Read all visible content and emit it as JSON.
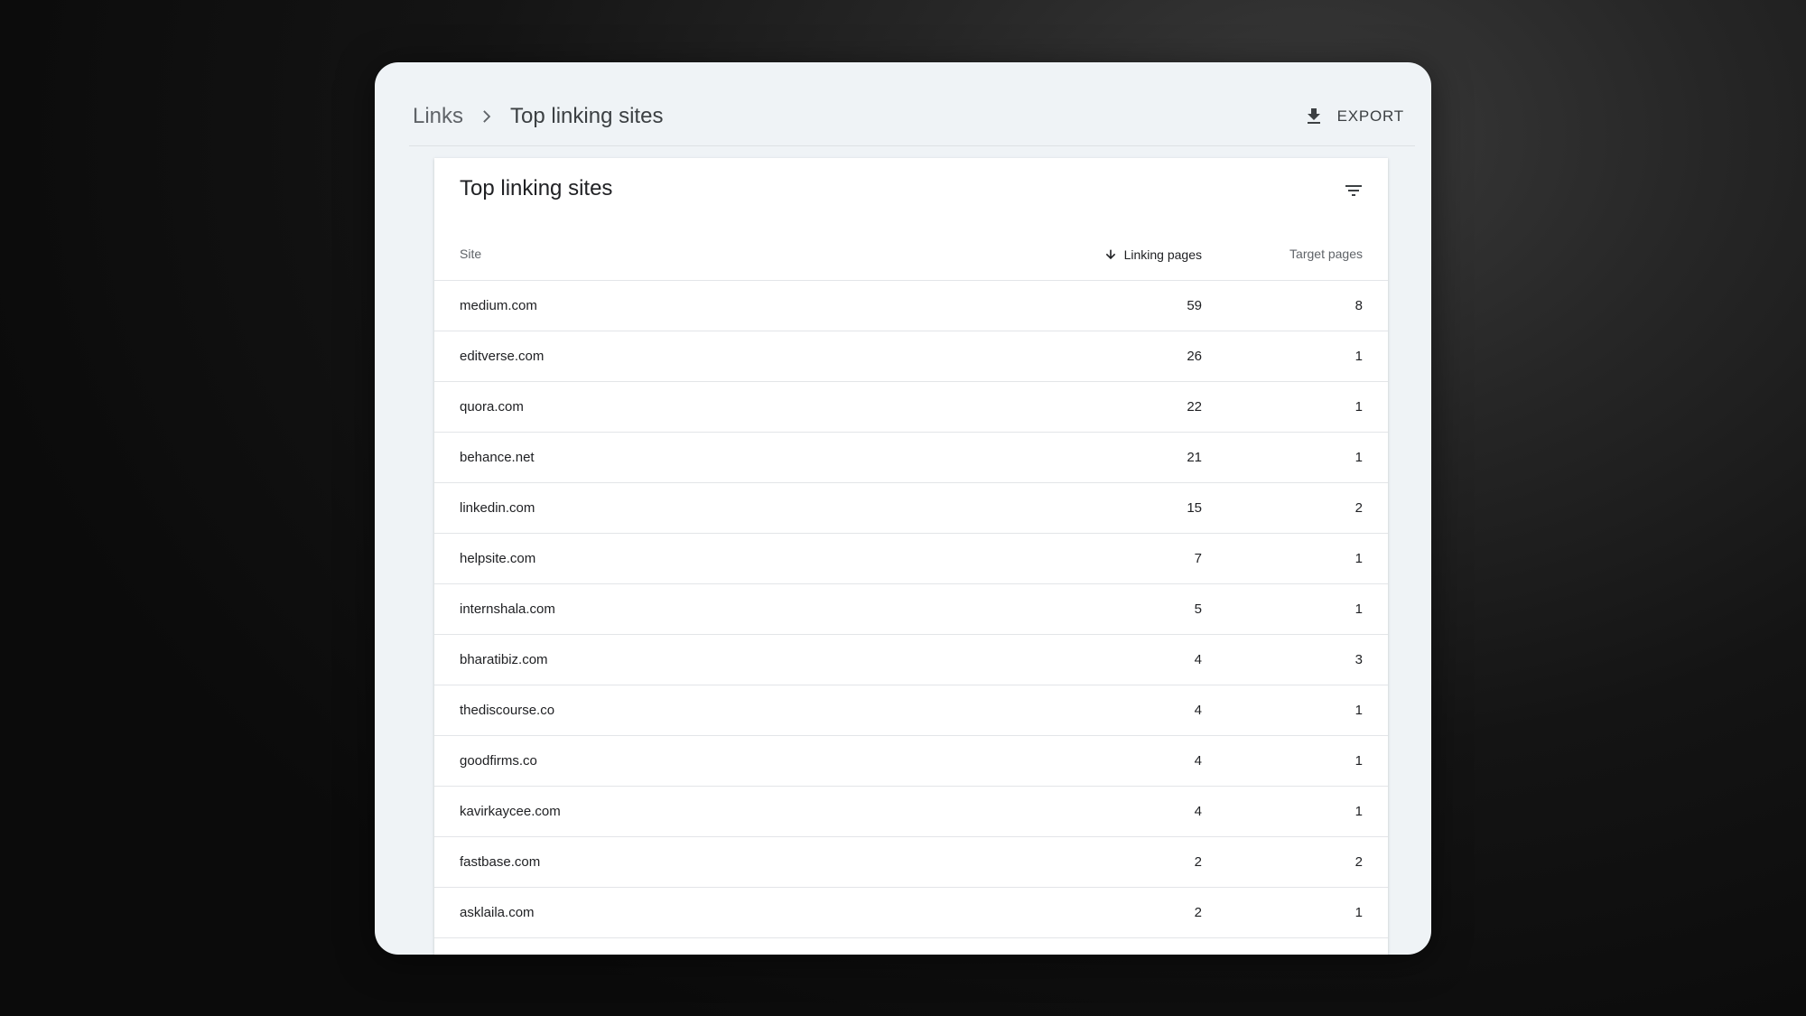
{
  "breadcrumb": {
    "parent": "Links",
    "current": "Top linking sites"
  },
  "toolbar": {
    "export_label": "EXPORT"
  },
  "card": {
    "title": "Top linking sites"
  },
  "table": {
    "columns": {
      "site": "Site",
      "linking_pages": "Linking pages",
      "target_pages": "Target pages"
    },
    "sort": {
      "column": "linking_pages",
      "direction": "descending"
    },
    "rows": [
      {
        "site": "medium.com",
        "linking": "59",
        "target": "8"
      },
      {
        "site": "editverse.com",
        "linking": "26",
        "target": "1"
      },
      {
        "site": "quora.com",
        "linking": "22",
        "target": "1"
      },
      {
        "site": "behance.net",
        "linking": "21",
        "target": "1"
      },
      {
        "site": "linkedin.com",
        "linking": "15",
        "target": "2"
      },
      {
        "site": "helpsite.com",
        "linking": "7",
        "target": "1"
      },
      {
        "site": "internshala.com",
        "linking": "5",
        "target": "1"
      },
      {
        "site": "bharatibiz.com",
        "linking": "4",
        "target": "3"
      },
      {
        "site": "thediscourse.co",
        "linking": "4",
        "target": "1"
      },
      {
        "site": "goodfirms.co",
        "linking": "4",
        "target": "1"
      },
      {
        "site": "kavirkaycee.com",
        "linking": "4",
        "target": "1"
      },
      {
        "site": "fastbase.com",
        "linking": "2",
        "target": "2"
      },
      {
        "site": "asklaila.com",
        "linking": "2",
        "target": "1"
      }
    ]
  },
  "icons": {
    "breadcrumb_separator": "chevron-right-icon",
    "export": "download-icon",
    "filter": "filter-icon",
    "sort": "arrow-down-icon"
  },
  "colors": {
    "window_bg": "#eff3f6",
    "card_bg": "#ffffff",
    "text_primary": "#202124",
    "text_secondary": "#5f6368"
  }
}
